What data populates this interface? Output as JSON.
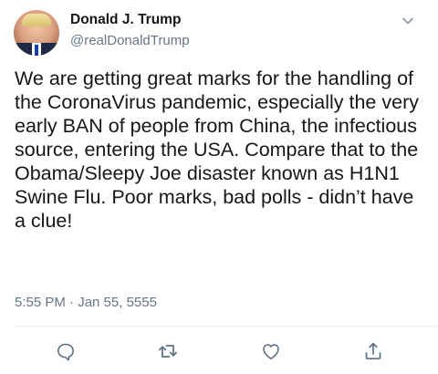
{
  "tweet": {
    "display_name": "Donald J. Trump",
    "handle": "@realDonaldTrump",
    "text": "We are getting great marks for the handling of the CoronaVirus pandemic, especially the very early BAN of people from China, the infectious source, entering the USA. Compare that to the Obama/Sleepy Joe disaster known as H1N1 Swine Flu. Poor marks, bad polls - didn’t have a clue!",
    "timestamp": "5:55 PM · Jan 55, 5555"
  },
  "icons": {
    "menu": "chevron-down-icon",
    "reply": "reply-icon",
    "retweet": "retweet-icon",
    "like": "heart-icon",
    "share": "share-icon"
  },
  "colors": {
    "text": "#14171a",
    "secondary": "#657786",
    "divider": "#e6ecf0"
  }
}
